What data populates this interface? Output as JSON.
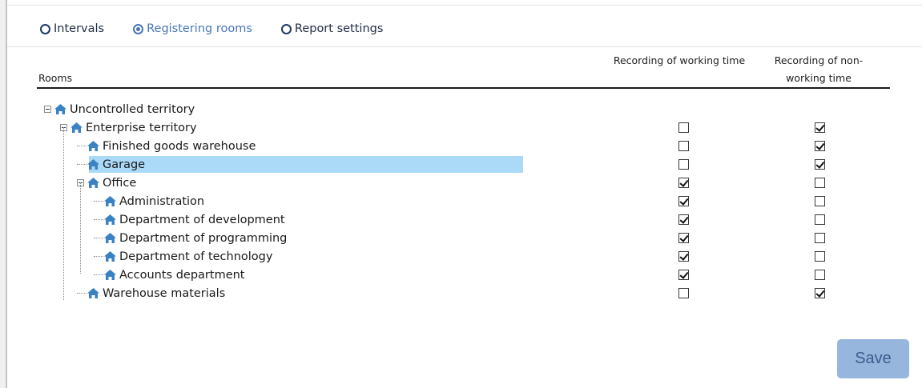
{
  "tabs": [
    {
      "label": "Intervals",
      "selected": false
    },
    {
      "label": "Registering rooms",
      "selected": true
    },
    {
      "label": "Report settings",
      "selected": false
    }
  ],
  "table": {
    "headers": {
      "rooms": "Rooms",
      "working": "Recording of working time",
      "non_working": "Recording of non-working time"
    }
  },
  "rooms": [
    {
      "name": "Uncontrolled territory",
      "level": 0,
      "expanded": true,
      "working": null,
      "non_working": null,
      "selected": false
    },
    {
      "name": "Enterprise territory",
      "level": 1,
      "expanded": true,
      "working": false,
      "non_working": true,
      "selected": false
    },
    {
      "name": "Finished goods warehouse",
      "level": 2,
      "working": false,
      "non_working": true,
      "selected": false
    },
    {
      "name": "Garage",
      "level": 2,
      "working": false,
      "non_working": true,
      "selected": true
    },
    {
      "name": "Office",
      "level": 2,
      "expanded": true,
      "working": true,
      "non_working": false,
      "selected": false
    },
    {
      "name": "Administration",
      "level": 3,
      "working": true,
      "non_working": false,
      "selected": false
    },
    {
      "name": "Department of development",
      "level": 3,
      "working": true,
      "non_working": false,
      "selected": false
    },
    {
      "name": "Department of programming",
      "level": 3,
      "working": true,
      "non_working": false,
      "selected": false
    },
    {
      "name": "Department of technology",
      "level": 3,
      "working": true,
      "non_working": false,
      "selected": false
    },
    {
      "name": "Accounts department",
      "level": 3,
      "working": true,
      "non_working": false,
      "selected": false
    },
    {
      "name": "Warehouse materials",
      "level": 2,
      "working": false,
      "non_working": true,
      "selected": false
    }
  ],
  "actions": {
    "save_label": "Save"
  },
  "colors": {
    "accent": "#4a76b8",
    "selection": "#aadaf7",
    "button": "#97b6de",
    "house_icon": "#3b82c4"
  },
  "icons": {
    "room": "house-icon",
    "expander": "collapse-icon"
  }
}
